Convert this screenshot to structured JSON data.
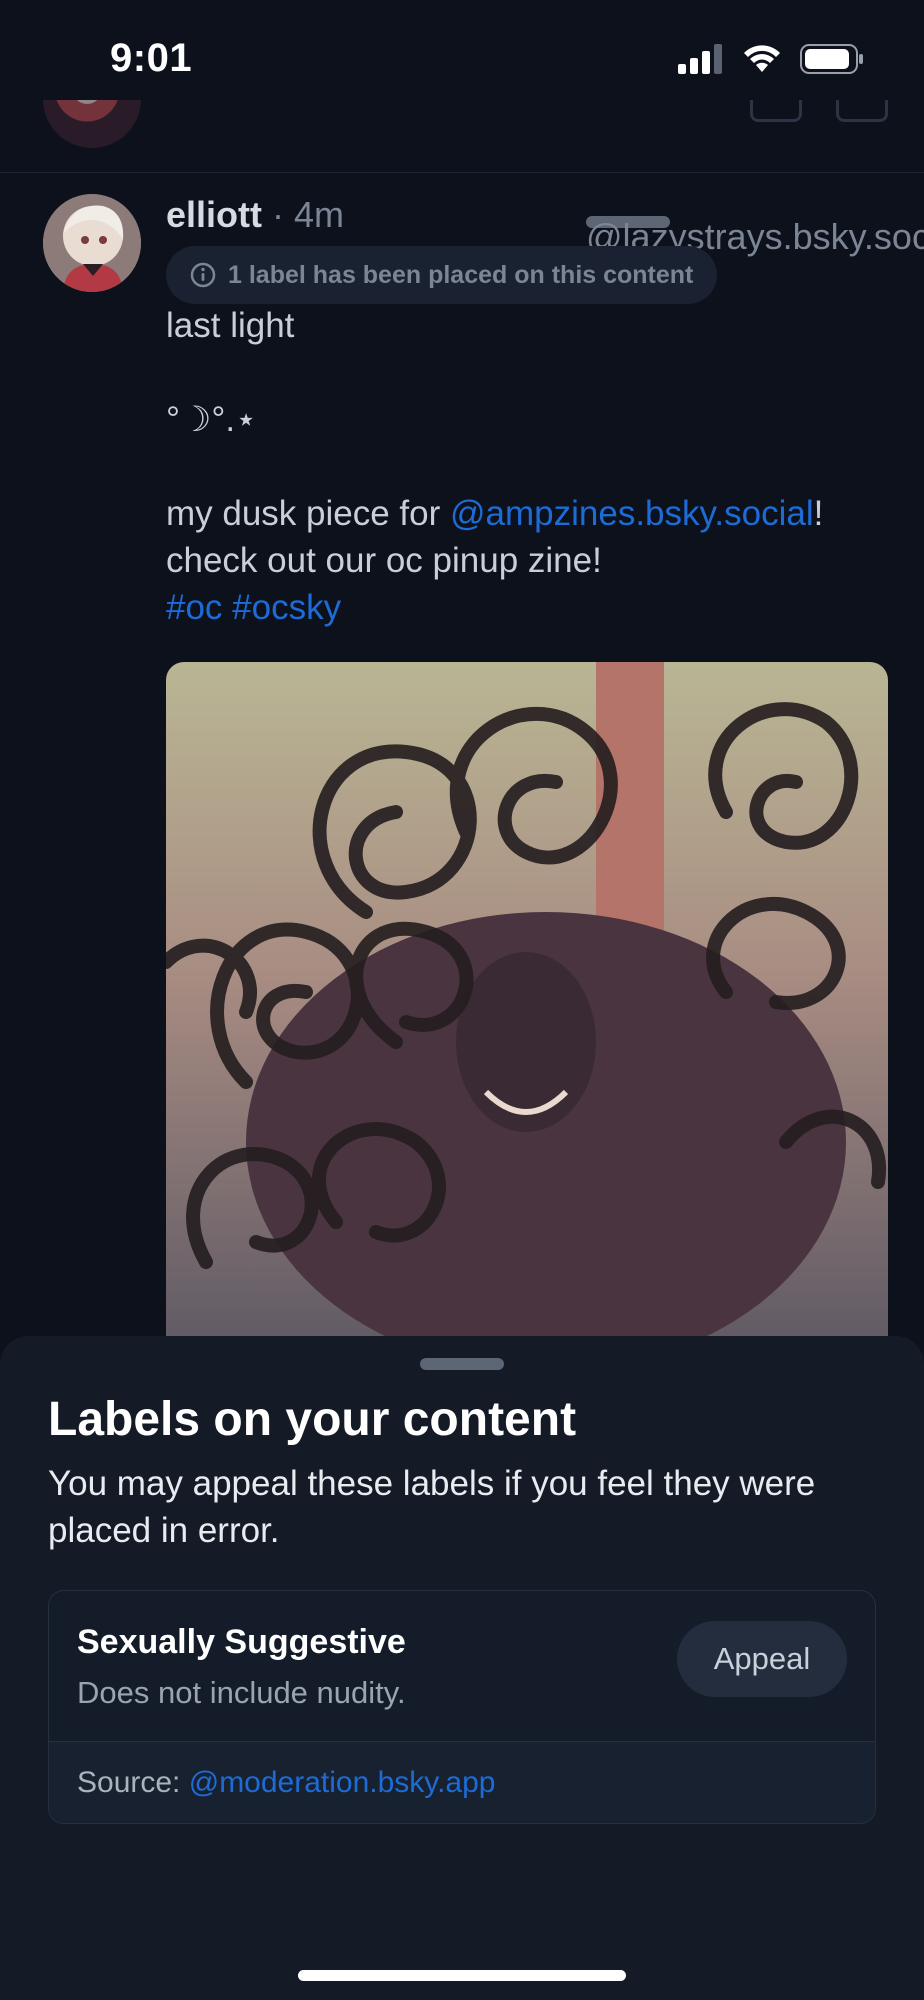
{
  "status_bar": {
    "time": "9:01"
  },
  "post": {
    "author_name": "elliott",
    "author_handle": "@lazystrays.bsky.social",
    "separator": "·",
    "time_ago": "4m",
    "label_notice": "1 label has been placed on this content",
    "text": {
      "line1": "last light",
      "line2": "°☽°.⋆",
      "line3_pre": "my dusk piece for ",
      "line3_mention": "@ampzines.bsky.social",
      "line3_post": "!",
      "line4": "check out our oc pinup zine!",
      "hashtag1": "#oc",
      "hashtag2": "#ocsky"
    }
  },
  "sheet": {
    "title": "Labels on your content",
    "subtitle": "You may appeal these labels if you feel they were placed in error.",
    "labels": [
      {
        "name": "Sexually Suggestive",
        "description": "Does not include nudity.",
        "appeal_label": "Appeal",
        "source_prefix": "Source: ",
        "source_handle": "@moderation.bsky.app"
      }
    ]
  },
  "colors": {
    "background": "#0c111c",
    "sheet": "#141b27",
    "link": "#1d6bd6"
  }
}
